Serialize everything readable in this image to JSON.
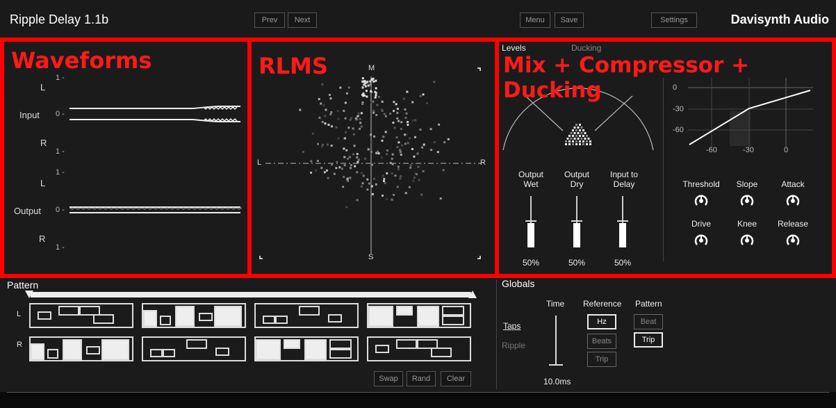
{
  "header": {
    "title": "Ripple Delay 1.1b",
    "prev": "Prev",
    "next": "Next",
    "menu": "Menu",
    "save": "Save",
    "settings": "Settings",
    "brand": "Davisynth Audio"
  },
  "overlay_labels": {
    "waveforms": "Waveforms",
    "rlms": "RLMS",
    "mix": "Mix + Compressor + Ducking"
  },
  "waveforms": {
    "L": "L",
    "R": "R",
    "input": "Input",
    "output": "Output",
    "one": "1 -",
    "zero": "0 -"
  },
  "rlms": {
    "M": "M",
    "S": "S",
    "L": "L",
    "R": "R"
  },
  "mix": {
    "tabs": [
      "Levels",
      "Ducking"
    ],
    "faders": [
      {
        "label1": "Output",
        "label2": "Wet",
        "value": "50%",
        "level": 0.5
      },
      {
        "label1": "Output",
        "label2": "Dry",
        "value": "50%",
        "level": 0.5
      },
      {
        "label1": "Input to",
        "label2": "Delay",
        "value": "50%",
        "level": 0.5
      }
    ],
    "comp_y_ticks": [
      "0",
      "-30",
      "-60"
    ],
    "comp_x_ticks": [
      "-60",
      "-30",
      "0"
    ],
    "knobs": [
      "Threshold",
      "Slope",
      "Attack",
      "Drive",
      "Knee",
      "Release"
    ]
  },
  "pattern": {
    "title": "Pattern",
    "L": "L",
    "R": "R",
    "swap": "Swap",
    "rand": "Rand",
    "clear": "Clear"
  },
  "globals": {
    "title": "Globals",
    "time_header": "Time",
    "reference_header": "Reference",
    "pattern_header": "Pattern",
    "taps": "Taps",
    "ripple": "Ripple",
    "time_value": "10.0ms",
    "reference_options": [
      "Hz",
      "Beats",
      "Trip"
    ],
    "reference_selected": "Hz",
    "pattern_options": [
      "Beat",
      "Trip"
    ],
    "pattern_selected": "Trip"
  },
  "colors": {
    "overlay_red": "#ff0000",
    "background": "#0a0a0a",
    "panel": "#1b1b1b"
  }
}
